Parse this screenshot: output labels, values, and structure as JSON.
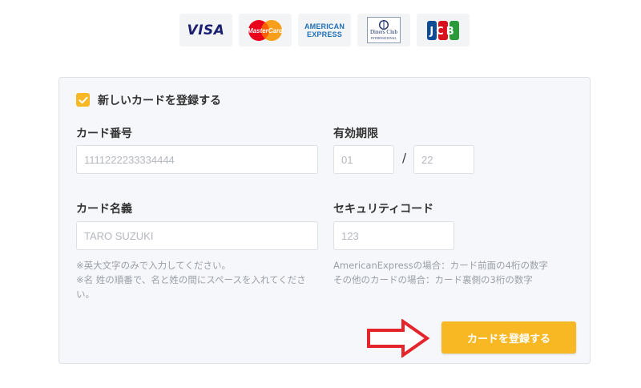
{
  "brands": {
    "visa": "VISA",
    "mastercard": "MasterCard",
    "amex_line1": "AMERICAN",
    "amex_line2": "EXPRESS",
    "diners_line1": "Diners Club",
    "diners_line2": "INTERNATIONAL",
    "jcb": "JCB"
  },
  "form": {
    "save_checkbox_label": "新しいカードを登録する",
    "save_checked": true,
    "card_number_label": "カード番号",
    "card_number_placeholder": "1111222233334444",
    "expiry_label": "有効期限",
    "expiry_month_placeholder": "01",
    "expiry_separator": "/",
    "expiry_year_placeholder": "22",
    "card_name_label": "カード名義",
    "card_name_placeholder": "TARO SUZUKI",
    "security_label": "セキュリティコード",
    "security_placeholder": "123",
    "name_note_1": "※英大文字のみで入力してください。",
    "name_note_2": "※名 姓の順番で、名と姓の間にスペースを入れてください。",
    "security_note_1": "AmericanExpressの場合：カード前面の4桁の数字",
    "security_note_2": "その他のカードの場合：カード裏側の3桁の数字",
    "submit_label": "カードを登録する"
  },
  "colors": {
    "accent": "#f7b824",
    "arrow": "#e3262b",
    "panel_bg": "#f6f7fa"
  },
  "icons": {
    "checkbox": "check-icon",
    "pointer": "right-arrow-icon"
  }
}
